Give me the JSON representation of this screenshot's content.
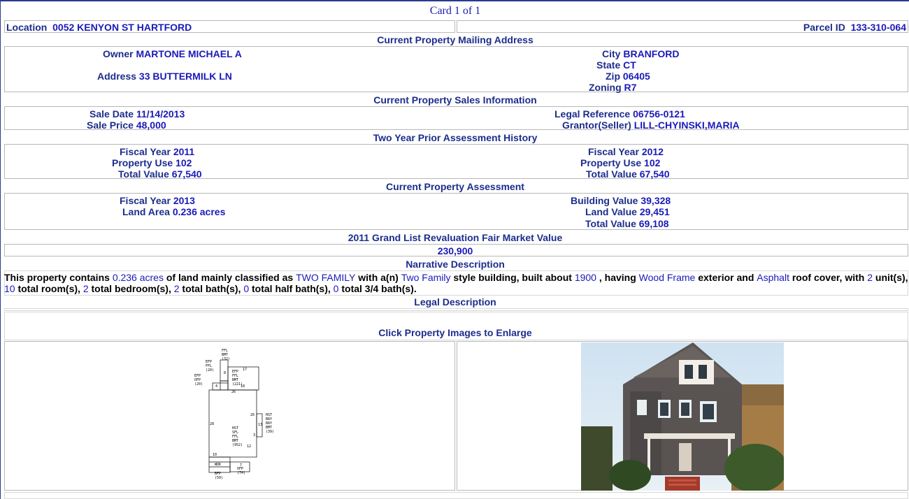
{
  "card": {
    "title": "Card 1 of 1"
  },
  "location": {
    "label": "Location",
    "value": "0052 KENYON ST HARTFORD"
  },
  "parcel": {
    "label": "Parcel ID",
    "value": "133-310-064"
  },
  "mailing": {
    "header": "Current Property Mailing Address",
    "owner_label": "Owner",
    "owner": "MARTONE MICHAEL A",
    "address_label": "Address",
    "address": "33 BUTTERMILK LN",
    "city_label": "City",
    "city": "BRANFORD",
    "state_label": "State",
    "state": "CT",
    "zip_label": "Zip",
    "zip": "06405",
    "zoning_label": "Zoning",
    "zoning": "R7"
  },
  "sales": {
    "header": "Current Property Sales Information",
    "sale_date_label": "Sale Date",
    "sale_date": "11/14/2013",
    "sale_price_label": "Sale Price",
    "sale_price": "48,000",
    "legal_ref_label": "Legal Reference",
    "legal_ref": "06756-0121",
    "grantor_label": "Grantor(Seller)",
    "grantor": "LILL-CHYINSKI,MARIA"
  },
  "prior": {
    "header": "Two Year Prior Assessment History",
    "left": {
      "fy_label": "Fiscal Year",
      "fy": "2011",
      "use_label": "Property Use",
      "use": "102",
      "total_label": "Total Value",
      "total": "67,540"
    },
    "right": {
      "fy_label": "Fiscal Year",
      "fy": "2012",
      "use_label": "Property Use",
      "use": "102",
      "total_label": "Total Value",
      "total": "67,540"
    }
  },
  "current": {
    "header": "Current Property Assessment",
    "fy_label": "Fiscal Year",
    "fy": "2013",
    "land_area_label": "Land Area",
    "land_area": "0.236 acres",
    "building_label": "Building Value",
    "building": "39,328",
    "land_value_label": "Land Value",
    "land_value": "29,451",
    "total_label": "Total Value",
    "total": "69,108"
  },
  "revaluation": {
    "header": "2011 Grand List Revaluation Fair Market Value",
    "value": "230,900"
  },
  "narrative": {
    "header": "Narrative Description",
    "t1": "This property contains ",
    "acres": "0.236 acres",
    "t2": " of land mainly classified as ",
    "class": "TWO FAMILY",
    "t3": " with a(n) ",
    "style": "Two Family",
    "t4": " style building, built about ",
    "year": "1900",
    "t5": " , having ",
    "exterior": "Wood Frame",
    "t6": " exterior and ",
    "roof": "Asphalt",
    "t7": " roof cover, with ",
    "units": "2",
    "t8": " unit(s), ",
    "rooms": "10",
    "t9": " total room(s), ",
    "bedrooms": "2",
    "t10": " total bedroom(s), ",
    "baths": "2",
    "t11": " total bath(s), ",
    "half_baths": "0",
    "t12": " total half bath(s), ",
    "three_q_baths": "0",
    "t13": " total 3/4 bath(s)."
  },
  "legal": {
    "header": "Legal Description"
  },
  "images": {
    "header": "Click Property Images to Enlarge",
    "sketch_labels": {
      "l1": "FFL",
      "l2": "BMT",
      "l3": "(32)",
      "l4": "EFP",
      "l5": "FFL",
      "l6": "(20)",
      "l7": "EFP",
      "l8": "OFP",
      "l9": "(20)",
      "l10": "EFP",
      "l11": "FFL",
      "l12": "BMT",
      "l13": "(221)",
      "l14": "HST",
      "l15": "SFL",
      "l16": "FFL",
      "l17": "BMT",
      "l18": "(952)",
      "l19": "HST",
      "l20": "BAY",
      "l21": "BAY",
      "l22": "BMT",
      "l23": "(39)",
      "l24": "WDK",
      "l25": "OFP",
      "l26": "(74)",
      "l27": "BFP",
      "l28": "(50)",
      "n1": "17",
      "n2": "8",
      "n3": "26",
      "n4": "28",
      "n5": "12",
      "n6": "10",
      "n7": "3",
      "n8": "13",
      "n9": "18",
      "n10": "4",
      "n11": "7",
      "n12": "26"
    }
  },
  "colors": {
    "accent": "#1a1ab8",
    "label": "#1c2d8c",
    "border": "#b8b8b8",
    "frame": "#2a3a8c"
  }
}
